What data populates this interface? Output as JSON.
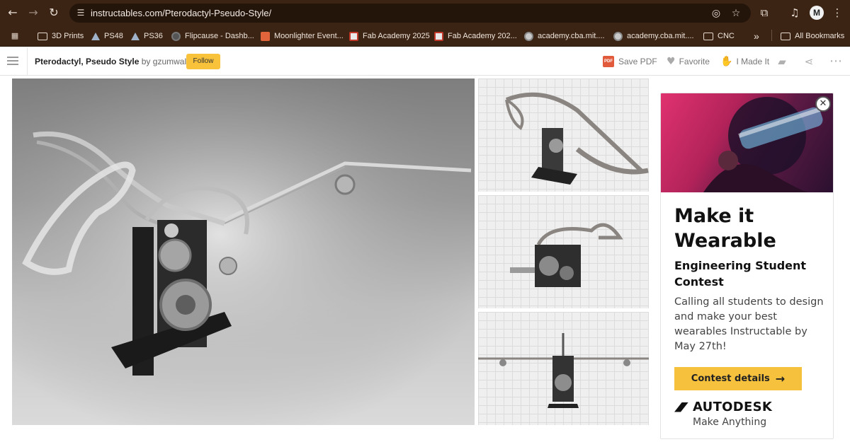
{
  "browser": {
    "url": "instructables.com/Pterodactyl-Pseudo-Style/",
    "profile_initial": "M",
    "bookmarks": [
      {
        "label": "3D Prints"
      },
      {
        "label": "PS48"
      },
      {
        "label": "PS36"
      },
      {
        "label": "Flipcause - Dashb..."
      },
      {
        "label": "Moonlighter Event..."
      },
      {
        "label": "Fab Academy 2025"
      },
      {
        "label": "Fab Academy 202..."
      },
      {
        "label": "academy.cba.mit...."
      },
      {
        "label": "academy.cba.mit...."
      },
      {
        "label": "CNC"
      }
    ],
    "more_bookmarks": "»",
    "all_bookmarks": "All Bookmarks"
  },
  "header": {
    "title": "Pterodactyl, Pseudo Style",
    "by": "by",
    "author": "gzumwalt",
    "follow_label": "Follow",
    "save_pdf_label": "Save PDF",
    "pdf_badge": "PDF",
    "favorite_label": "Favorite",
    "made_it_label": "I Made It"
  },
  "ad": {
    "headline": "Make it Wearable",
    "subheadline": "Engineering Student Contest",
    "body": "Calling all students to design and make your best wearables Instructable by May 27th!",
    "cta_label": "Contest details",
    "cta_arrow": "→",
    "brand": "AUTODESK",
    "tagline": "Make Anything",
    "close_glyph": "✕"
  },
  "icons": {
    "back": "back-arrow-icon",
    "forward": "forward-arrow-icon",
    "reload": "reload-icon",
    "site_settings": "tune-icon",
    "eye_off": "eye-off-icon",
    "star": "star-icon",
    "extensions": "puzzle-icon",
    "media": "media-queue-icon",
    "menu": "kebab-menu-icon",
    "apps": "apps-grid-icon",
    "hamburger": "hamburger-menu-icon",
    "comments": "comments-icon",
    "share": "share-icon",
    "more": "more-dots-icon"
  },
  "colors": {
    "chrome": "#3b2414",
    "follow_button": "#f8c23a",
    "cta_button": "#f6c13c",
    "pdf_badge": "#e05a3b"
  }
}
